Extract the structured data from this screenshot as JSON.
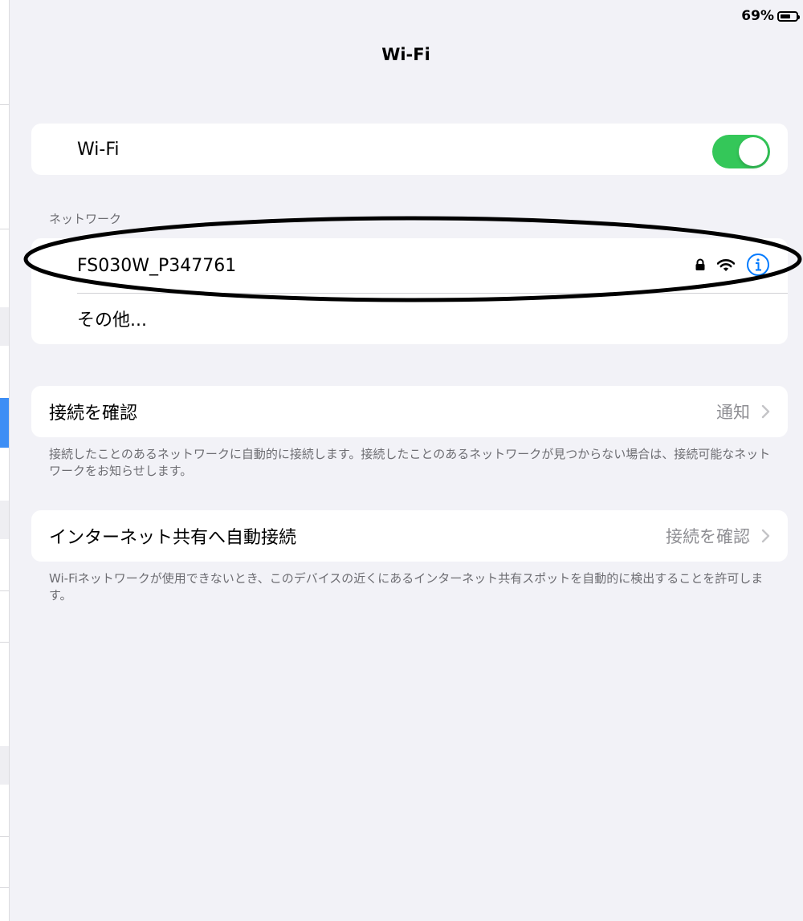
{
  "status_bar": {
    "battery_percent": "69%",
    "battery_level": 0.69
  },
  "nav": {
    "title": "Wi-Fi"
  },
  "wifi_toggle": {
    "label": "Wi-Fi",
    "on": true
  },
  "networks": {
    "header": "ネットワーク",
    "items": [
      {
        "name": "FS030W_P347761",
        "secured": true,
        "icons": [
          "lock-icon",
          "wifi-icon",
          "info-icon"
        ]
      },
      {
        "name": "その他..."
      }
    ]
  },
  "ask_to_join": {
    "label": "接続を確認",
    "value": "通知",
    "footer": "接続したことのあるネットワークに自動的に接続します。接続したことのあるネットワークが見つからない場合は、接続可能なネットワークをお知らせします。"
  },
  "auto_join_hotspot": {
    "label": "インターネット共有へ自動接続",
    "value": "接続を確認",
    "footer": "Wi-Fiネットワークが使用できないとき、このデバイスの近くにあるインターネット共有スポットを自動的に検出することを許可します。"
  },
  "colors": {
    "accent": "#007aff",
    "toggle_on": "#34c759",
    "background": "#f2f2f7",
    "secondary_text": "#6d6d72",
    "detail_text": "#8e8e93"
  }
}
